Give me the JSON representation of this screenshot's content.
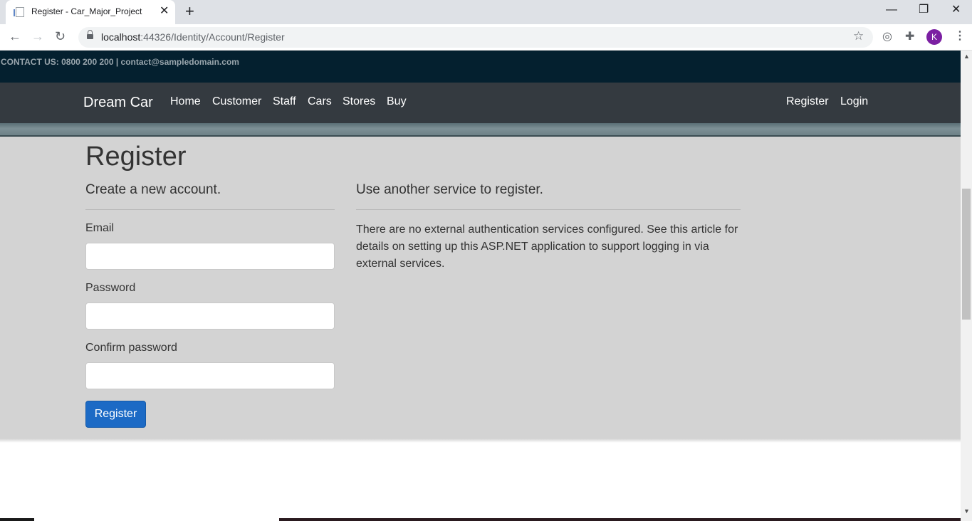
{
  "browser": {
    "tab_title": "Register - Car_Major_Project",
    "tab_close": "✕",
    "new_tab": "+",
    "url_host": "localhost",
    "url_rest": ":44326/Identity/Account/Register",
    "profile_initial": "K",
    "controls": {
      "minimize": "—",
      "restore": "❐",
      "close": "✕"
    }
  },
  "contact": {
    "text": "CONTACT US: 0800 200 200 | contact@sampledomain.com"
  },
  "navbar": {
    "brand": "Dream Car",
    "links": [
      "Home",
      "Customer",
      "Staff",
      "Cars",
      "Stores",
      "Buy"
    ],
    "right_links": [
      "Register",
      "Login"
    ]
  },
  "register": {
    "title": "Register",
    "subtitle": "Create a new account.",
    "email_label": "Email",
    "password_label": "Password",
    "confirm_label": "Confirm password",
    "email_value": "",
    "password_value": "",
    "confirm_value": "",
    "button_label": "Register"
  },
  "external": {
    "heading": "Use another service to register.",
    "text": "There are no external authentication services configured. See this article for details on setting up this ASP.NET application to support logging in via external services."
  }
}
